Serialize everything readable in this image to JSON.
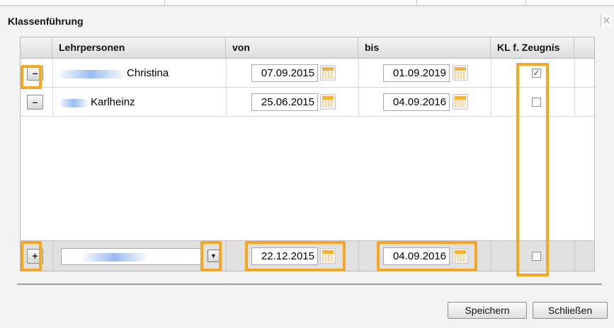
{
  "dialog": {
    "title": "Klassenführung",
    "close_glyph": "×"
  },
  "table": {
    "columns": [
      "Lehrpersonen",
      "von",
      "bis",
      "KL f. Zeugnis"
    ],
    "rows": [
      {
        "remove_label": "–",
        "name": "Christina",
        "von": "07.09.2015",
        "bis": "01.09.2019",
        "kl_checked": true
      },
      {
        "remove_label": "–",
        "name": "Karlheinz",
        "von": "25.06.2015",
        "bis": "04.09.2016",
        "kl_checked": false
      }
    ],
    "new_row": {
      "add_label": "+",
      "von": "22.12.2015",
      "bis": "04.09.2016",
      "kl_checked": false,
      "dropdown_glyph": "▼"
    }
  },
  "footer": {
    "save_label": "Speichern",
    "close_label": "Schließen"
  },
  "icons": {
    "calendar": "calendar-icon",
    "remove": "minus-icon",
    "add": "plus-icon",
    "close": "close-icon",
    "dropdown": "chevron-down-icon"
  },
  "colors": {
    "highlight": "#f5a623",
    "calendar_accent": "#f4b13a",
    "check": "#3a4f8c"
  }
}
